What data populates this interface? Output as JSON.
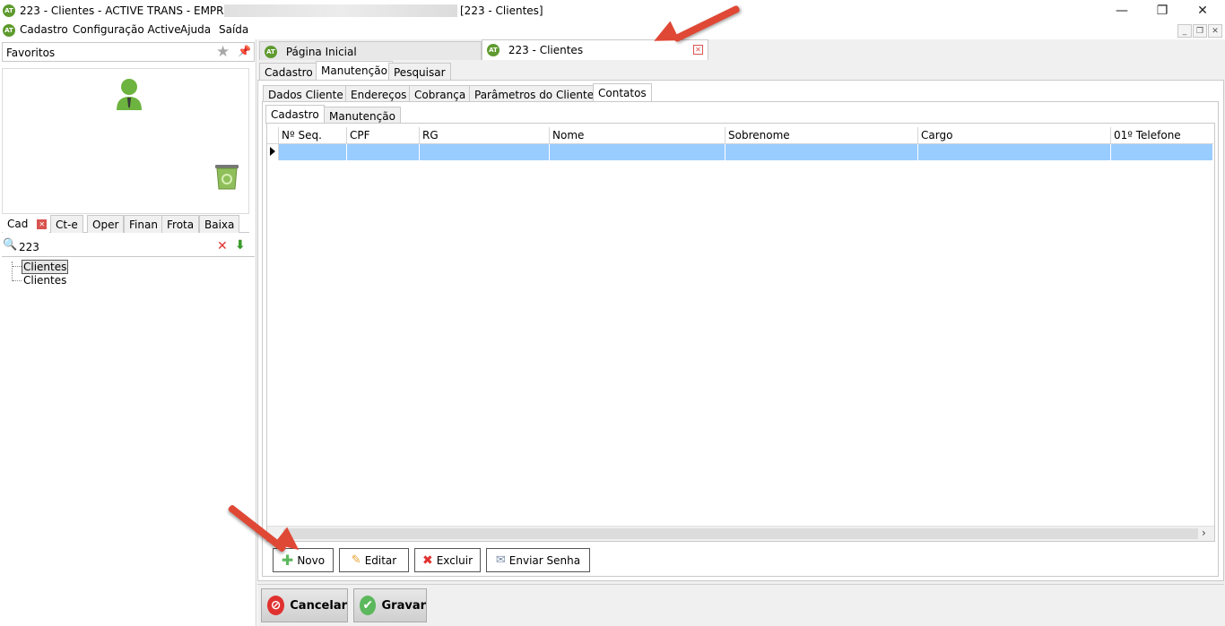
{
  "window": {
    "title_prefix": "223 - Clientes - ACTIVE TRANS - EMPRESA:",
    "title_suffix": "[223 - Clientes]",
    "logo_text": "AT"
  },
  "menubar": {
    "items": [
      "Cadastro",
      "Configuração Active",
      "Ajuda",
      "Saída"
    ]
  },
  "left_panel": {
    "favorites_label": "Favoritos",
    "bottom_tabs": [
      "Cad",
      "Ct-e",
      "Oper",
      "Finan",
      "Frota",
      "Baixa"
    ],
    "search_value": "223",
    "tree_items": [
      "Clientes",
      "Clientes"
    ]
  },
  "doc_tabs": [
    "Página Inicial",
    "223 - Clientes"
  ],
  "main_tabs": [
    "Cadastro",
    "Manutenção",
    "Pesquisar"
  ],
  "sub_tabs": [
    "Dados Cliente",
    "Endereços",
    "Cobrança",
    "Parâmetros do Cliente",
    "Contatos"
  ],
  "inner_tabs": [
    "Cadastro",
    "Manutenção"
  ],
  "grid": {
    "columns": [
      "Nº Seq.",
      "CPF",
      "RG",
      "Nome",
      "Sobrenome",
      "Cargo",
      "01º Telefone"
    ]
  },
  "actions": {
    "novo": "Novo",
    "editar": "Editar",
    "excluir": "Excluir",
    "enviar_senha": "Enviar Senha"
  },
  "footer": {
    "cancelar": "Cancelar",
    "gravar": "Gravar"
  },
  "colors": {
    "accent_green": "#5e9a2e",
    "row_selected": "#99ccff",
    "arrow": "#e04836"
  }
}
